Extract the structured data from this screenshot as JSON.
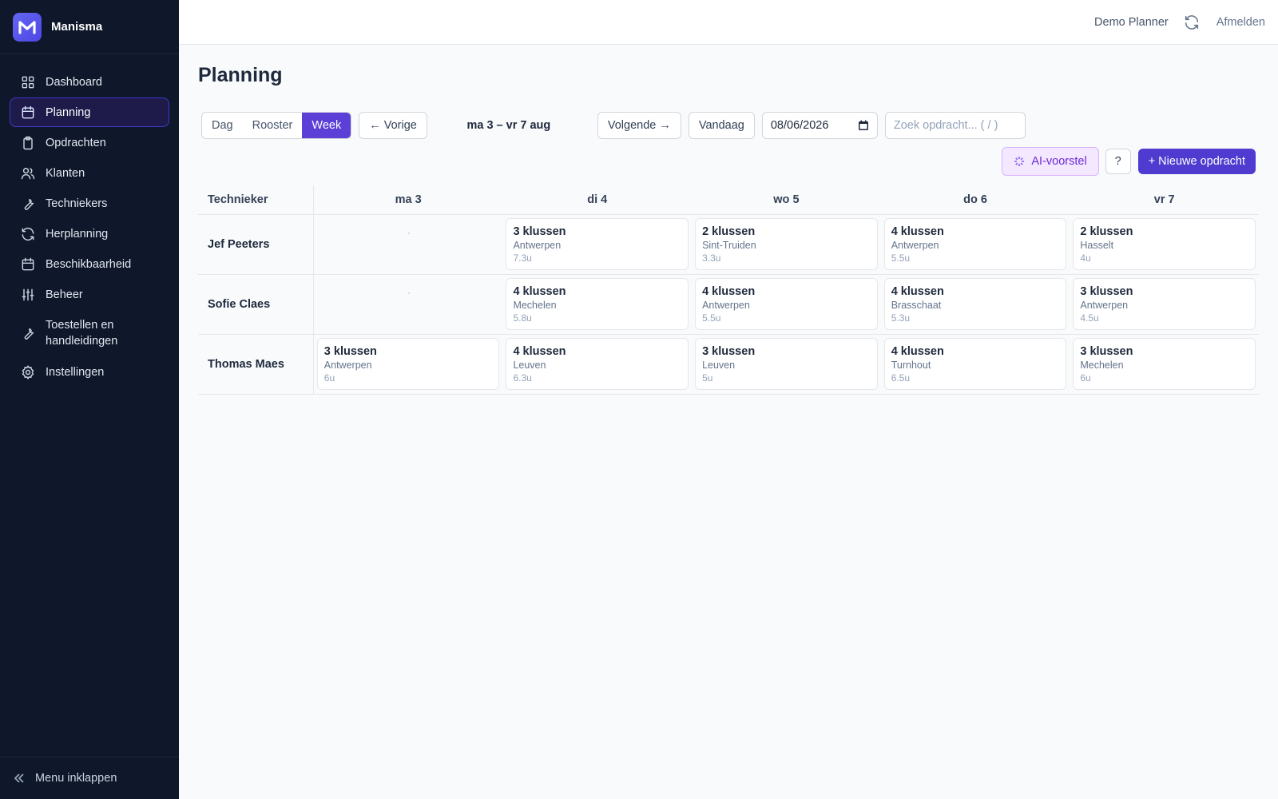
{
  "brand": {
    "name": "Manisma"
  },
  "sidebar": {
    "items": [
      {
        "label": "Dashboard",
        "icon": "grid-icon",
        "active": false
      },
      {
        "label": "Planning",
        "icon": "calendar-icon",
        "active": true
      },
      {
        "label": "Opdrachten",
        "icon": "clipboard-icon",
        "active": false
      },
      {
        "label": "Klanten",
        "icon": "users-icon",
        "active": false
      },
      {
        "label": "Techniekers",
        "icon": "wrench-icon",
        "active": false
      },
      {
        "label": "Herplanning",
        "icon": "refresh-icon",
        "active": false
      },
      {
        "label": "Beschikbaarheid",
        "icon": "calendar-icon",
        "active": false
      },
      {
        "label": "Beheer",
        "icon": "sliders-icon",
        "active": false
      },
      {
        "label": "Toestellen en handleidingen",
        "icon": "wrench-icon",
        "active": false
      },
      {
        "label": "Instellingen",
        "icon": "gear-icon",
        "active": false
      }
    ],
    "collapse_label": "Menu inklappen"
  },
  "topbar": {
    "user": "Demo Planner",
    "logout": "Afmelden"
  },
  "page": {
    "title": "Planning"
  },
  "toolbar": {
    "views": [
      "Dag",
      "Rooster",
      "Week"
    ],
    "active_view": "Week",
    "prev_label": "← Vorige",
    "range_label": "ma 3 – vr 7 aug",
    "next_label": "Volgende →",
    "today_label": "Vandaag",
    "date_value": "08/06/2026",
    "search_placeholder": "Zoek opdracht... ( / )"
  },
  "actions": {
    "ai_label": "AI-voorstel",
    "help_label": "?",
    "new_label": "+ Nieuwe opdracht"
  },
  "grid": {
    "tech_header": "Technieker",
    "days": [
      "ma 3",
      "di 4",
      "wo 5",
      "do 6",
      "vr 7"
    ],
    "rows": [
      {
        "name": "Jef Peeters",
        "cells": [
          null,
          {
            "count": "3 klussen",
            "city": "Antwerpen",
            "hours": "7.3u"
          },
          {
            "count": "2 klussen",
            "city": "Sint-Truiden",
            "hours": "3.3u"
          },
          {
            "count": "4 klussen",
            "city": "Antwerpen",
            "hours": "5.5u"
          },
          {
            "count": "2 klussen",
            "city": "Hasselt",
            "hours": "4u"
          }
        ]
      },
      {
        "name": "Sofie Claes",
        "cells": [
          null,
          {
            "count": "4 klussen",
            "city": "Mechelen",
            "hours": "5.8u"
          },
          {
            "count": "4 klussen",
            "city": "Antwerpen",
            "hours": "5.5u"
          },
          {
            "count": "4 klussen",
            "city": "Brasschaat",
            "hours": "5.3u"
          },
          {
            "count": "3 klussen",
            "city": "Antwerpen",
            "hours": "4.5u"
          }
        ]
      },
      {
        "name": "Thomas Maes",
        "cells": [
          {
            "count": "3 klussen",
            "city": "Antwerpen",
            "hours": "6u"
          },
          {
            "count": "4 klussen",
            "city": "Leuven",
            "hours": "6.3u"
          },
          {
            "count": "3 klussen",
            "city": "Leuven",
            "hours": "5u"
          },
          {
            "count": "4 klussen",
            "city": "Turnhout",
            "hours": "6.5u"
          },
          {
            "count": "3 klussen",
            "city": "Mechelen",
            "hours": "6u"
          }
        ]
      }
    ]
  }
}
